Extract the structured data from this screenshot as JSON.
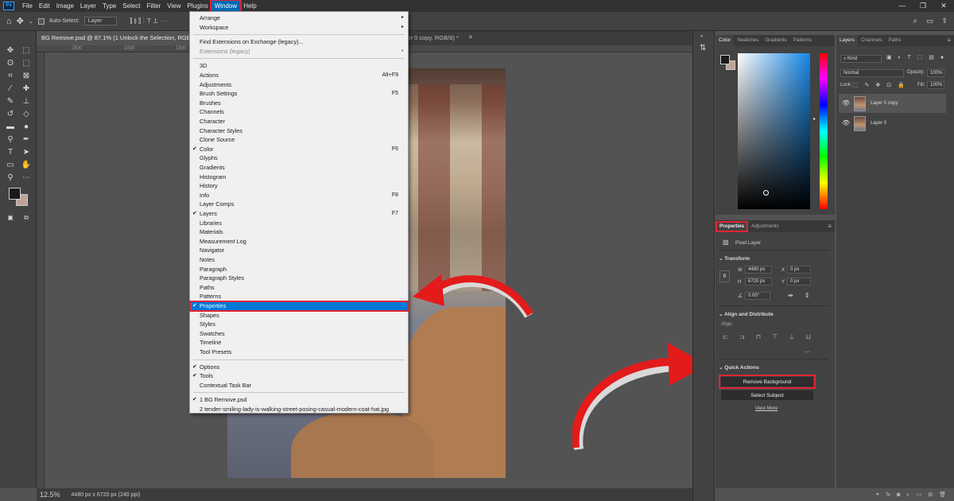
{
  "menubar": {
    "logo": "Ps",
    "items": [
      "File",
      "Edit",
      "Image",
      "Layer",
      "Type",
      "Select",
      "Filter",
      "View",
      "Plugins",
      "Window",
      "Help"
    ],
    "active": "Window"
  },
  "options": {
    "autoselect_label": "Auto-Select:",
    "autoselect_value": "Layer"
  },
  "tabs": [
    {
      "label": "BG Remove.psd @ 87.1% (1 Unlock the Selection, RGB/8)"
    },
    {
      "label": "12.5% (Layer 0 copy, RGB/8) *"
    }
  ],
  "ruler_ticks": [
    "2500",
    "2000",
    "1500"
  ],
  "status": {
    "zoom": "12.5%",
    "info": "4480 px x 6720 px (240 ppi)"
  },
  "window_menu": {
    "items": [
      {
        "label": "Arrange",
        "arrow": "▸"
      },
      {
        "label": "Workspace",
        "arrow": "▸"
      },
      {
        "sep": true
      },
      {
        "label": "Find Extensions on Exchange (legacy)..."
      },
      {
        "label": "Extensions (legacy)",
        "arrow": "▸",
        "disabled": true
      },
      {
        "sep": true
      },
      {
        "label": "3D"
      },
      {
        "label": "Actions",
        "shortcut": "Alt+F9"
      },
      {
        "label": "Adjustments"
      },
      {
        "label": "Brush Settings",
        "shortcut": "F5"
      },
      {
        "label": "Brushes"
      },
      {
        "label": "Channels"
      },
      {
        "label": "Character"
      },
      {
        "label": "Character Styles"
      },
      {
        "label": "Clone Source"
      },
      {
        "label": "Color",
        "shortcut": "F6",
        "checked": true
      },
      {
        "label": "Glyphs"
      },
      {
        "label": "Gradients"
      },
      {
        "label": "Histogram"
      },
      {
        "label": "History"
      },
      {
        "label": "Info",
        "shortcut": "F8"
      },
      {
        "label": "Layer Comps"
      },
      {
        "label": "Layers",
        "shortcut": "F7",
        "checked": true
      },
      {
        "label": "Libraries"
      },
      {
        "label": "Materials"
      },
      {
        "label": "Measurement Log"
      },
      {
        "label": "Navigator"
      },
      {
        "label": "Notes"
      },
      {
        "label": "Paragraph"
      },
      {
        "label": "Paragraph Styles"
      },
      {
        "label": "Paths"
      },
      {
        "label": "Patterns"
      },
      {
        "label": "Properties",
        "checked": true,
        "highlighted": true
      },
      {
        "label": "Shapes"
      },
      {
        "label": "Styles"
      },
      {
        "label": "Swatches"
      },
      {
        "label": "Timeline"
      },
      {
        "label": "Tool Presets"
      },
      {
        "sep": true
      },
      {
        "label": "Options",
        "checked": true
      },
      {
        "label": "Tools",
        "checked": true
      },
      {
        "label": "Contextual Task Bar"
      },
      {
        "sep": true
      },
      {
        "label": "1 BG Remove.psd",
        "checked": true
      },
      {
        "label": "2 tender-smiling-lady-is-walking-street-posing-casual-modern-coat-hat.jpg"
      }
    ]
  },
  "color_panel": {
    "tabs": [
      "Color",
      "Swatches",
      "Gradients",
      "Patterns"
    ]
  },
  "layers_panel": {
    "tabs": [
      "Layers",
      "Channels",
      "Paths"
    ],
    "kind": "Kind",
    "blend": "Normal",
    "opacity_label": "Opacity:",
    "opacity": "100%",
    "lock_label": "Lock:",
    "fill_label": "Fill:",
    "fill": "100%",
    "layers": [
      "Layer 0 copy",
      "Layer 0"
    ]
  },
  "properties": {
    "tabs": [
      "Properties",
      "Adjustments"
    ],
    "kind": "Pixel Layer",
    "transform": {
      "title": "Transform",
      "w_label": "W",
      "w": "4480 px",
      "h_label": "H",
      "h": "6720 px",
      "x_label": "X",
      "x": "0 px",
      "y_label": "Y",
      "y": "0 px",
      "angle": "0.00°"
    },
    "align_title": "Align and Distribute",
    "align_label": "Align:",
    "more": "...",
    "quick_title": "Quick Actions",
    "remove_bg": "Remove Background",
    "select_subject": "Select Subject",
    "view_more": "View More"
  },
  "colors": {
    "accent": "#e02434",
    "highlight": "#0078d7",
    "fg_swatch": "#1a1a1a",
    "bg_swatch": "#c2a296"
  }
}
